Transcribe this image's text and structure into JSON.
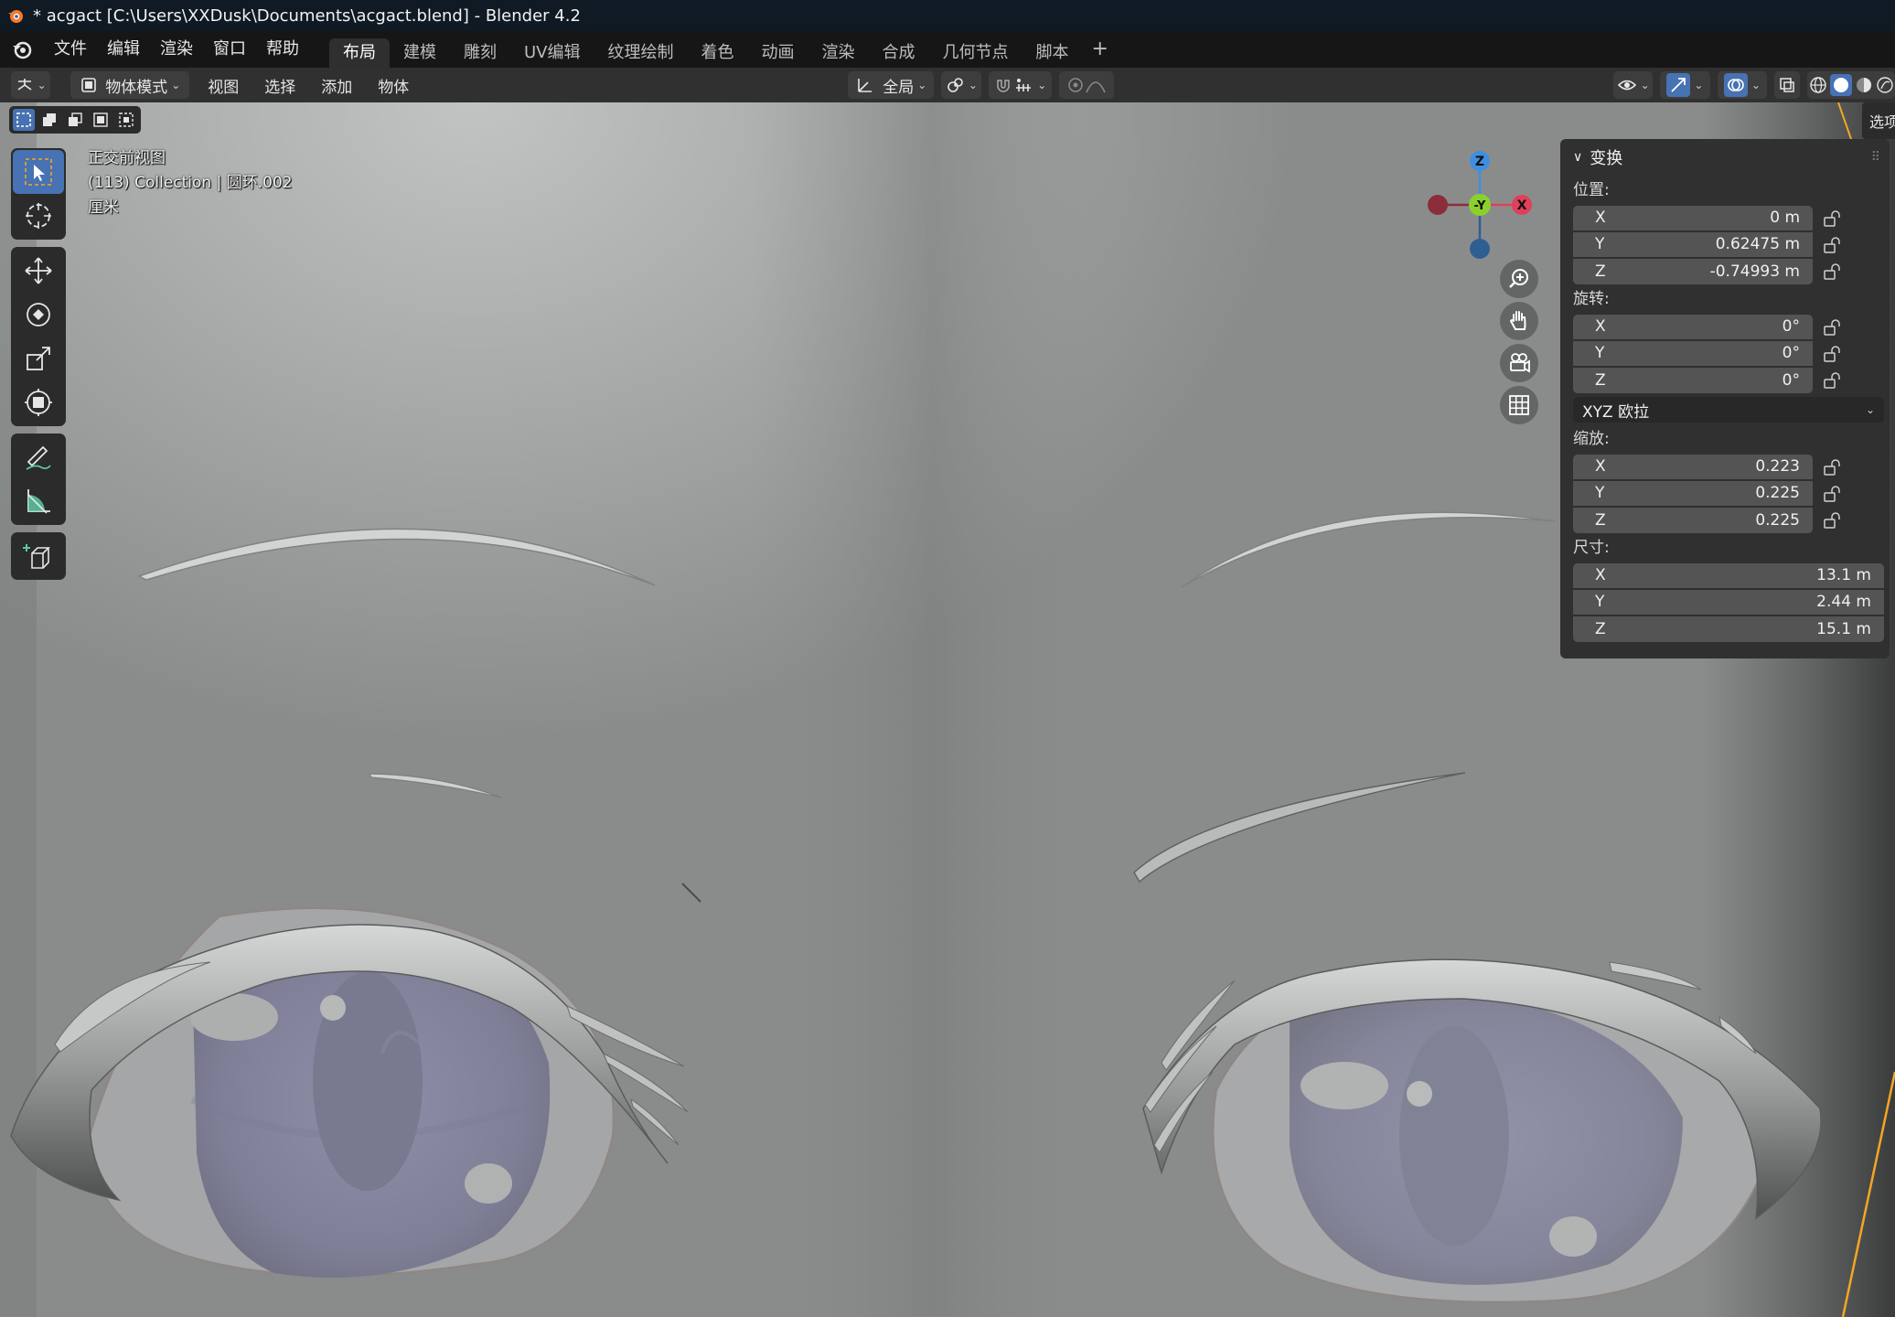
{
  "window": {
    "title": "* acgact [C:\\Users\\XXDusk\\Documents\\acgact.blend] - Blender 4.2"
  },
  "menubar": {
    "items": [
      "文件",
      "编辑",
      "渲染",
      "窗口",
      "帮助"
    ],
    "workspaces": [
      "布局",
      "建模",
      "雕刻",
      "UV编辑",
      "纹理绘制",
      "着色",
      "动画",
      "渲染",
      "合成",
      "几何节点",
      "脚本"
    ],
    "active_workspace": "布局",
    "add_label": "+"
  },
  "header": {
    "mode": "物体模式",
    "menus": [
      "视图",
      "选择",
      "添加",
      "物体"
    ],
    "orientation": "全局"
  },
  "viewport": {
    "view_name": "正交前视图",
    "collection": "(113) Collection | 圆环.002",
    "units": "厘米"
  },
  "gizmo": {
    "z": "Z",
    "y": "-Y",
    "x": "X"
  },
  "sidebar": {
    "tab_label": "选项",
    "panel_title": "变换",
    "location": {
      "label": "位置:",
      "rows": [
        {
          "axis": "X",
          "value": "0 m"
        },
        {
          "axis": "Y",
          "value": "0.62475 m"
        },
        {
          "axis": "Z",
          "value": "-0.74993 m"
        }
      ]
    },
    "rotation": {
      "label": "旋转:",
      "rows": [
        {
          "axis": "X",
          "value": "0°"
        },
        {
          "axis": "Y",
          "value": "0°"
        },
        {
          "axis": "Z",
          "value": "0°"
        }
      ],
      "mode": "XYZ 欧拉"
    },
    "scale": {
      "label": "缩放:",
      "rows": [
        {
          "axis": "X",
          "value": "0.223"
        },
        {
          "axis": "Y",
          "value": "0.225"
        },
        {
          "axis": "Z",
          "value": "0.225"
        }
      ]
    },
    "dimensions": {
      "label": "尺寸:",
      "rows": [
        {
          "axis": "X",
          "value": "13.1 m"
        },
        {
          "axis": "Y",
          "value": "2.44 m"
        },
        {
          "axis": "Z",
          "value": "15.1 m"
        }
      ]
    }
  },
  "colors": {
    "accent": "#4772b3",
    "axis_x": "#e0405a",
    "axis_y": "#8bd12d",
    "axis_z": "#3f8fe0",
    "active_object_outline": "#f5a623"
  }
}
